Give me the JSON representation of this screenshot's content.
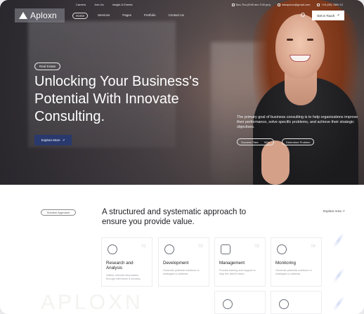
{
  "topbar": {
    "links": [
      "Careers",
      "Join Us",
      "Insight & Events"
    ],
    "hours": "Sun-Thu (9:00 am-7:00 pm)",
    "email": "infoaploxn@gmail.com",
    "phone": "+10 (00) 7890 12"
  },
  "brand": {
    "name": "Aploxn"
  },
  "nav": {
    "items": [
      "Home",
      "Services",
      "Pages",
      "Portfolio",
      "Contact Us"
    ],
    "cta": "Get in Touch"
  },
  "hero": {
    "badge": "Real Estate",
    "title_lines": [
      "Unlocking Your Business's",
      "Potential With Innovate",
      "Consulting."
    ],
    "button": "Explore More",
    "description": "The primary goal of business consulting is to help organizations improve their performance, solve specific problems, and achieve their strategic objectives.",
    "stat_label": "Success Rate",
    "stat_value": "90%",
    "secondary": "Determine Problem"
  },
  "approach": {
    "badge": "Solution Approach",
    "title": "A structured and systematic approach to ensure you provide value.",
    "explore": "Explore Area"
  },
  "cards": [
    {
      "number": "01",
      "title": "Research and Analysis",
      "text": "Gather relevant information through interviews & surveys."
    },
    {
      "number": "02",
      "title": "Development",
      "text": "Generate potential solutions or strategies to address."
    },
    {
      "number": "03",
      "title": "Management",
      "text": "Provide training and support to help the client's team."
    },
    {
      "number": "04",
      "title": "Monitoring",
      "text": "Generate potential solutions or strategies to address."
    }
  ],
  "watermark": "APLOXN",
  "icons": {
    "arrow": "arrow-up-right-icon",
    "search": "search-icon"
  },
  "colors": {
    "accent": "#29396e"
  }
}
